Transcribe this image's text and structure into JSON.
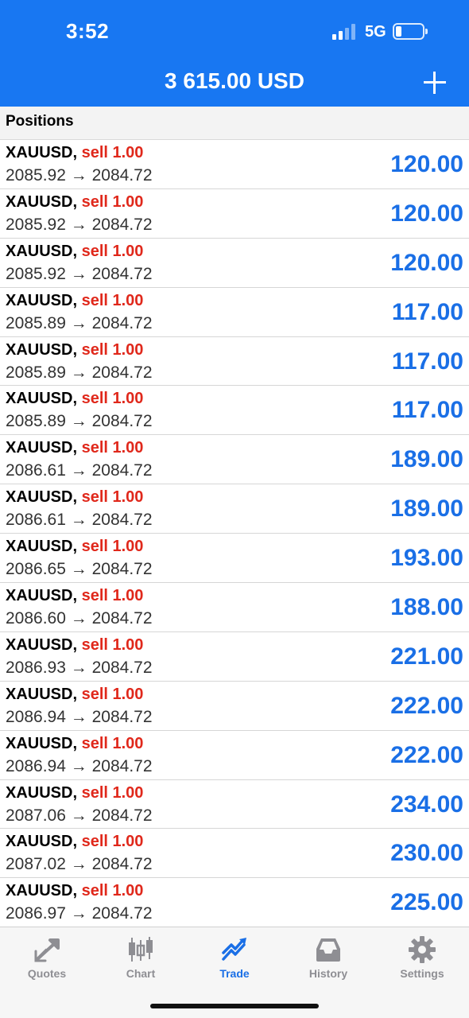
{
  "status": {
    "time": "3:52",
    "network": "5G"
  },
  "header": {
    "balance": "3 615.00 USD"
  },
  "section": {
    "title": "Positions"
  },
  "positions": [
    {
      "symbol": "XAUUSD,",
      "side": "sell 1.00",
      "open": "2085.92",
      "arrow": "→",
      "current": "2084.72",
      "profit": "120.00"
    },
    {
      "symbol": "XAUUSD,",
      "side": "sell 1.00",
      "open": "2085.92",
      "arrow": "→",
      "current": "2084.72",
      "profit": "120.00"
    },
    {
      "symbol": "XAUUSD,",
      "side": "sell 1.00",
      "open": "2085.92",
      "arrow": "→",
      "current": "2084.72",
      "profit": "120.00"
    },
    {
      "symbol": "XAUUSD,",
      "side": "sell 1.00",
      "open": "2085.89",
      "arrow": "→",
      "current": "2084.72",
      "profit": "117.00"
    },
    {
      "symbol": "XAUUSD,",
      "side": "sell 1.00",
      "open": "2085.89",
      "arrow": "→",
      "current": "2084.72",
      "profit": "117.00"
    },
    {
      "symbol": "XAUUSD,",
      "side": "sell 1.00",
      "open": "2085.89",
      "arrow": "→",
      "current": "2084.72",
      "profit": "117.00"
    },
    {
      "symbol": "XAUUSD,",
      "side": "sell 1.00",
      "open": "2086.61",
      "arrow": "→",
      "current": "2084.72",
      "profit": "189.00"
    },
    {
      "symbol": "XAUUSD,",
      "side": "sell 1.00",
      "open": "2086.61",
      "arrow": "→",
      "current": "2084.72",
      "profit": "189.00"
    },
    {
      "symbol": "XAUUSD,",
      "side": "sell 1.00",
      "open": "2086.65",
      "arrow": "→",
      "current": "2084.72",
      "profit": "193.00"
    },
    {
      "symbol": "XAUUSD,",
      "side": "sell 1.00",
      "open": "2086.60",
      "arrow": "→",
      "current": "2084.72",
      "profit": "188.00"
    },
    {
      "symbol": "XAUUSD,",
      "side": "sell 1.00",
      "open": "2086.93",
      "arrow": "→",
      "current": "2084.72",
      "profit": "221.00"
    },
    {
      "symbol": "XAUUSD,",
      "side": "sell 1.00",
      "open": "2086.94",
      "arrow": "→",
      "current": "2084.72",
      "profit": "222.00"
    },
    {
      "symbol": "XAUUSD,",
      "side": "sell 1.00",
      "open": "2086.94",
      "arrow": "→",
      "current": "2084.72",
      "profit": "222.00"
    },
    {
      "symbol": "XAUUSD,",
      "side": "sell 1.00",
      "open": "2087.06",
      "arrow": "→",
      "current": "2084.72",
      "profit": "234.00"
    },
    {
      "symbol": "XAUUSD,",
      "side": "sell 1.00",
      "open": "2087.02",
      "arrow": "→",
      "current": "2084.72",
      "profit": "230.00"
    },
    {
      "symbol": "XAUUSD,",
      "side": "sell 1.00",
      "open": "2086.97",
      "arrow": "→",
      "current": "2084.72",
      "profit": "225.00"
    }
  ],
  "tabs": [
    {
      "label": "Quotes",
      "icon": "quotes-icon",
      "active": false
    },
    {
      "label": "Chart",
      "icon": "chart-icon",
      "active": false
    },
    {
      "label": "Trade",
      "icon": "trade-icon",
      "active": true
    },
    {
      "label": "History",
      "icon": "history-icon",
      "active": false
    },
    {
      "label": "Settings",
      "icon": "settings-icon",
      "active": false
    }
  ],
  "colors": {
    "accent": "#1877f2",
    "profit": "#1a6fe6",
    "sell": "#e0281b",
    "inactive": "#8e8e93"
  }
}
